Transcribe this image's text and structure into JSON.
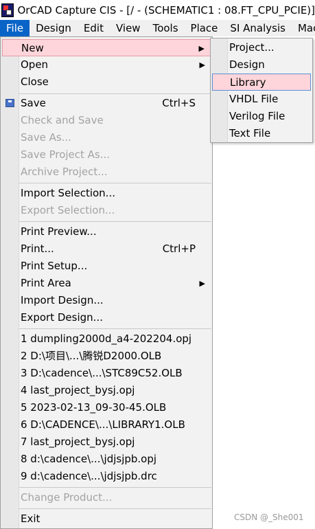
{
  "window": {
    "title": "OrCAD Capture CIS - [/ - (SCHEMATIC1 : 08.FT_CPU_PCIE)]"
  },
  "menubar": [
    "File",
    "Design",
    "Edit",
    "View",
    "Tools",
    "Place",
    "SI Analysis",
    "Macr"
  ],
  "file_menu": {
    "new": "New",
    "open": "Open",
    "close": "Close",
    "save": "Save",
    "save_shortcut": "Ctrl+S",
    "check_and_save": "Check and Save",
    "save_as": "Save As...",
    "save_project_as": "Save Project As...",
    "archive_project": "Archive Project...",
    "import_selection": "Import Selection...",
    "export_selection": "Export Selection...",
    "print_preview": "Print Preview...",
    "print": "Print...",
    "print_shortcut": "Ctrl+P",
    "print_setup": "Print Setup...",
    "print_area": "Print Area",
    "import_design": "Import Design...",
    "export_design": "Export Design...",
    "recent_files": [
      "1 dumpling2000d_a4-202204.opj",
      "2 D:\\项目\\...\\腾锐D2000.OLB",
      "3 D:\\cadence\\...\\STC89C52.OLB",
      "4 last_project_bysj.opj",
      "5 2023-02-13_09-30-45.OLB",
      "6 D:\\CADENCE\\...\\LIBRARY1.OLB",
      "7 last_project_bysj.opj",
      "8 d:\\cadence\\...\\jdjsjpb.opj",
      "9 d:\\cadence\\...\\jdjsjpb.drc"
    ],
    "change_product": "Change Product...",
    "exit": "Exit"
  },
  "new_submenu": [
    "Project...",
    "Design",
    "Library",
    "VHDL File",
    "Verilog File",
    "Text File"
  ],
  "watermark": "CSDN @_She001",
  "colors": {
    "menubar_active": "#0a63c7",
    "highlight": "#fdd5da",
    "disabled": "#a3a3a3"
  },
  "icons": [
    "app-icon",
    "save-icon",
    "submenu-arrow-icon"
  ]
}
